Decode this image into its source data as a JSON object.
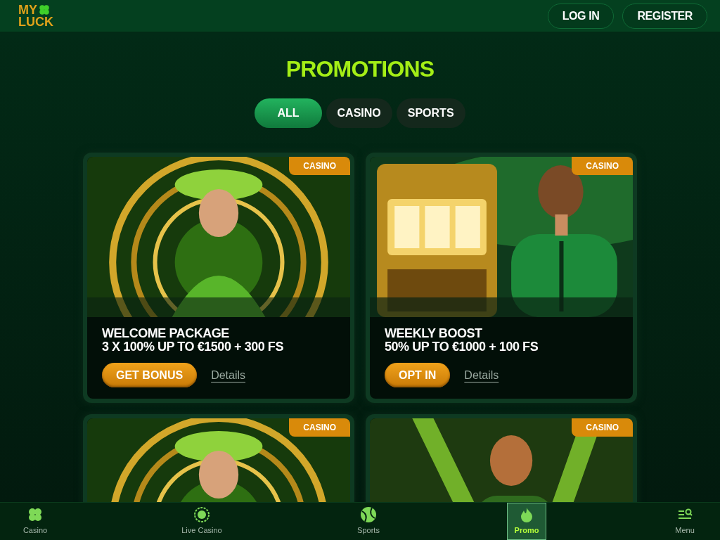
{
  "header": {
    "logo": {
      "line1": "MY",
      "line2": "LUCK"
    },
    "buttons": [
      {
        "label": "LOG IN"
      },
      {
        "label": "REGISTER"
      }
    ]
  },
  "title": "PROMOTIONS",
  "tabs": [
    {
      "label": "ALL",
      "selected": true
    },
    {
      "label": "CASINO",
      "selected": false
    },
    {
      "label": "SPORTS",
      "selected": false
    }
  ],
  "cards": [
    {
      "tag": "CASINO",
      "title": "WELCOME PACKAGE",
      "subtitle": "3 X 100% UP TO €1500 + 300 FS",
      "cta": "GET BONUS",
      "details": "Details"
    },
    {
      "tag": "CASINO",
      "title": "WEEKLY BOOST",
      "subtitle": "50% UP TO €1000 + 100 FS",
      "cta": "OPT IN",
      "details": "Details"
    },
    {
      "tag": "CASINO"
    },
    {
      "tag": "CASINO"
    }
  ],
  "bottom_nav": [
    {
      "label": "Casino",
      "selected": false
    },
    {
      "label": "Live Casino",
      "selected": false
    },
    {
      "label": "Sports",
      "selected": false
    },
    {
      "label": "Promo",
      "selected": true
    },
    {
      "label": "Menu",
      "selected": false
    }
  ]
}
